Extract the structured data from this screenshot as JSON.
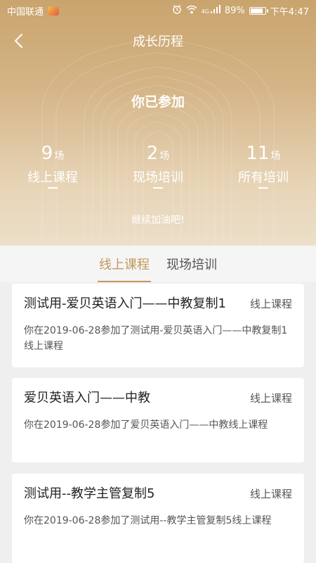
{
  "status_bar": {
    "carrier": "中国联通",
    "battery": "89%",
    "battery_level": 0.89,
    "time": "下午4:47",
    "network": "4G"
  },
  "nav": {
    "title": "成长历程",
    "back_icon": "chevron-left-icon"
  },
  "summary": {
    "title": "你已参加",
    "stats": [
      {
        "value": "9",
        "unit": "场",
        "label": "线上课程"
      },
      {
        "value": "2",
        "unit": "场",
        "label": "现场培训"
      },
      {
        "value": "11",
        "unit": "场",
        "label": "所有培训"
      }
    ],
    "encourage": "继续加油吧!"
  },
  "tabs": [
    {
      "label": "线上课程",
      "active": true
    },
    {
      "label": "现场培训",
      "active": false
    }
  ],
  "records": [
    {
      "title": "测试用-爱贝英语入门——中教复制1",
      "tag": "线上课程",
      "desc": "你在2019-06-28参加了测试用-爱贝英语入门——中教复制1线上课程"
    },
    {
      "title": "爱贝英语入门——中教",
      "tag": "线上课程",
      "desc": "你在2019-06-28参加了爱贝英语入门——中教线上课程"
    },
    {
      "title": "测试用--教学主管复制5",
      "tag": "线上课程",
      "desc": "你在2019-06-28参加了测试用--教学主管复制5线上课程"
    }
  ],
  "colors": {
    "accent": "#c29a5c",
    "hero_top": "#c9a46d",
    "hero_bottom": "#ecdfc9"
  }
}
